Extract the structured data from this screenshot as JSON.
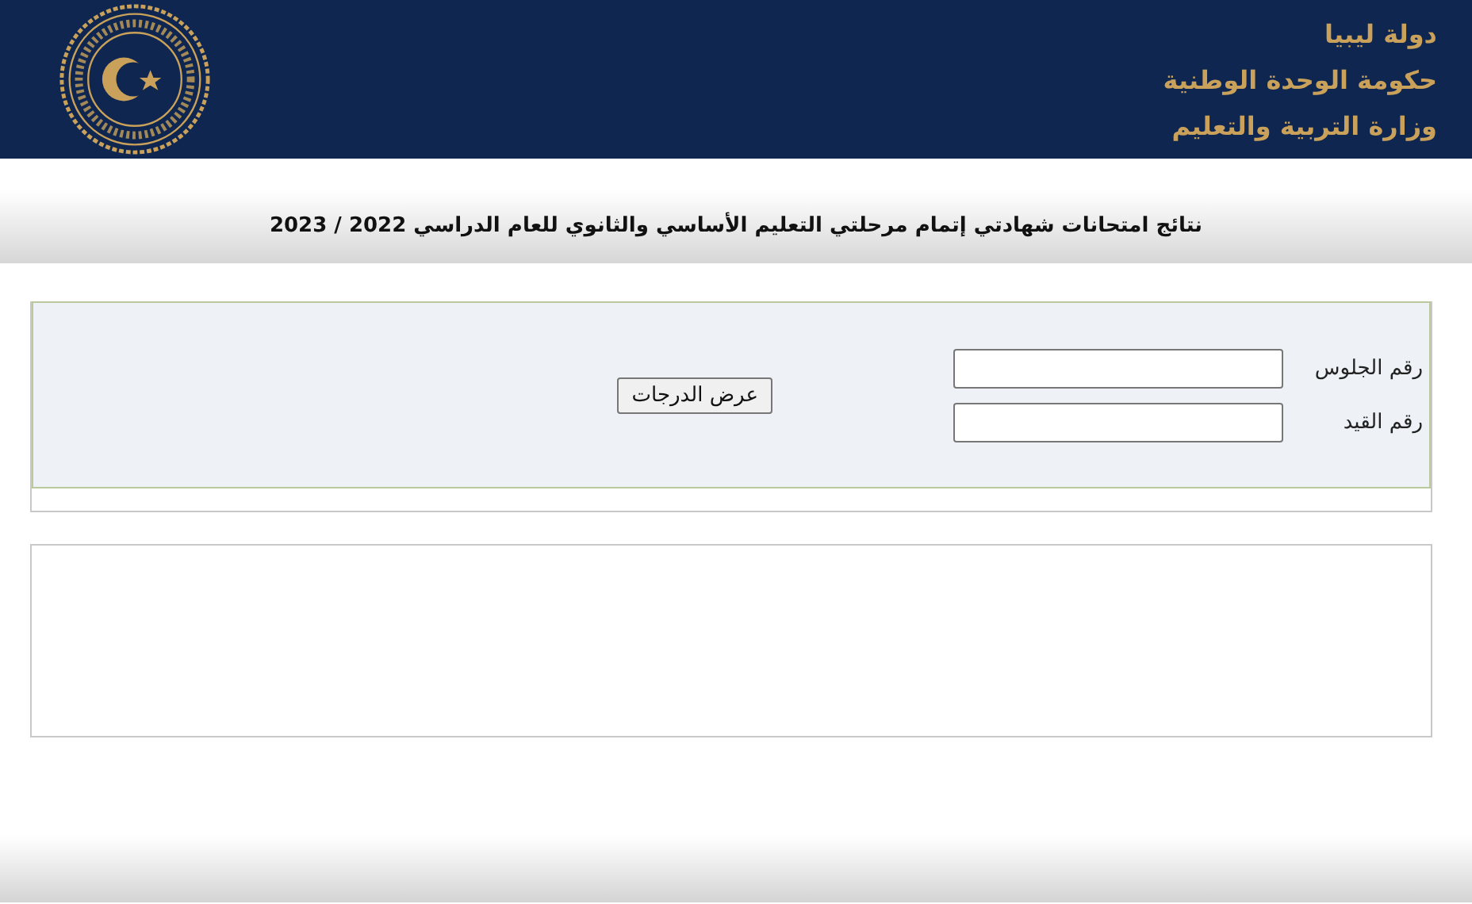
{
  "header": {
    "lines": [
      "دولة ليبيا",
      "حكومة الوحدة الوطنية",
      "وزارة التربية والتعليم"
    ]
  },
  "title": "نتائج امتحانات شهادتي إتمام مرحلتي التعليم الأساسي والثانوي للعام الدراسي 2022 / 2023",
  "form": {
    "fields": [
      {
        "label": "رقم الجلوس"
      },
      {
        "label": "رقم القيد"
      }
    ],
    "button": "عرض الدرجات"
  }
}
